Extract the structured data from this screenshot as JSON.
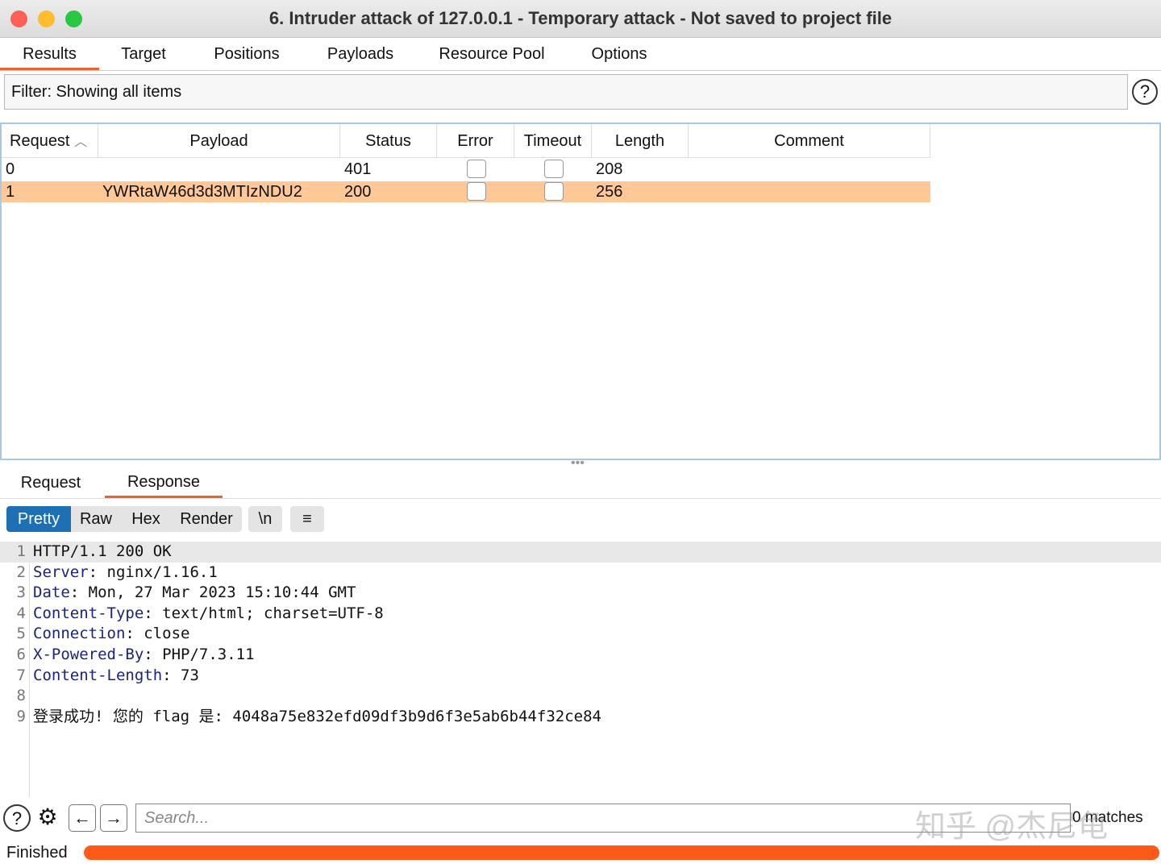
{
  "window": {
    "title": "6. Intruder attack of 127.0.0.1 - Temporary attack - Not saved to project file"
  },
  "tabs": [
    "Results",
    "Target",
    "Positions",
    "Payloads",
    "Resource Pool",
    "Options"
  ],
  "filter": {
    "label": "Filter: Showing all items"
  },
  "table": {
    "columns": [
      "Request",
      "Payload",
      "Status",
      "Error",
      "Timeout",
      "Length",
      "Comment"
    ],
    "rows": [
      {
        "request": "0",
        "payload": "",
        "status": "401",
        "error": false,
        "timeout": false,
        "length": "208",
        "comment": ""
      },
      {
        "request": "1",
        "payload": "YWRtaW46d3d3MTIzNDU2",
        "status": "200",
        "error": false,
        "timeout": false,
        "length": "256",
        "comment": ""
      }
    ]
  },
  "viewer_tabs": [
    "Request",
    "Response"
  ],
  "view_buttons": [
    "Pretty",
    "Raw",
    "Hex",
    "Render",
    "\\n",
    "≡"
  ],
  "response_lines": [
    {
      "n": "1",
      "key": "",
      "val": "HTTP/1.1 200 OK"
    },
    {
      "n": "2",
      "key": "Server",
      "val": " nginx/1.16.1"
    },
    {
      "n": "3",
      "key": "Date",
      "val": " Mon, 27 Mar 2023 15:10:44 GMT"
    },
    {
      "n": "4",
      "key": "Content-Type",
      "val": " text/html; charset=UTF-8"
    },
    {
      "n": "5",
      "key": "Connection",
      "val": " close"
    },
    {
      "n": "6",
      "key": "X-Powered-By",
      "val": " PHP/7.3.11"
    },
    {
      "n": "7",
      "key": "Content-Length",
      "val": " 73"
    },
    {
      "n": "8",
      "key": "",
      "val": ""
    },
    {
      "n": "9",
      "key": "",
      "val": "登录成功! 您的 flag 是: 4048a75e832efd09df3b9d6f3e5ab6b44f32ce84"
    }
  ],
  "search": {
    "placeholder": "Search...",
    "matches": "0 matches"
  },
  "status": {
    "label": "Finished",
    "progress": 100
  },
  "watermark": "知乎 @杰尼龟",
  "colors": {
    "accent": "#e8662c",
    "selected_row": "#ffc896",
    "progress": "#fd5a1a",
    "pretty": "#1f6fb5"
  }
}
